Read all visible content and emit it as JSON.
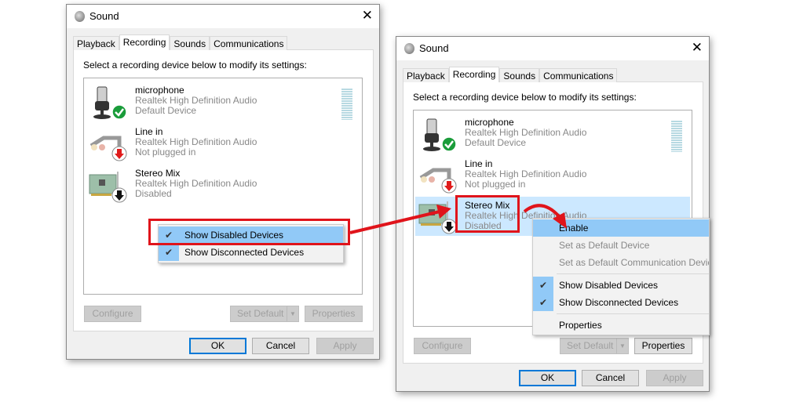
{
  "dialogs": [
    {
      "title": "Sound",
      "tabs": [
        "Playback",
        "Recording",
        "Sounds",
        "Communications"
      ],
      "instruction": "Select a recording device below to modify its settings:",
      "devices": [
        {
          "name": "microphone",
          "driver": "Realtek High Definition Audio",
          "status": "Default Device",
          "badge": "check-icon"
        },
        {
          "name": "Line in",
          "driver": "Realtek High Definition Audio",
          "status": "Not plugged in",
          "badge": "red-down-arrow-icon"
        },
        {
          "name": "Stereo Mix",
          "driver": "Realtek High Definition Audio",
          "status": "Disabled",
          "badge": "black-down-arrow-icon"
        }
      ],
      "buttons": {
        "configure": "Configure",
        "set_default": "Set Default",
        "properties": "Properties",
        "ok": "OK",
        "cancel": "Cancel",
        "apply": "Apply"
      },
      "menu": [
        {
          "label": "Show Disabled Devices",
          "checked": true
        },
        {
          "label": "Show Disconnected Devices",
          "checked": true
        }
      ]
    },
    {
      "title": "Sound",
      "tabs": [
        "Playback",
        "Recording",
        "Sounds",
        "Communications"
      ],
      "instruction": "Select a recording device below to modify its settings:",
      "devices": [
        {
          "name": "microphone",
          "driver": "Realtek High Definition Audio",
          "status": "Default Device",
          "badge": "check-icon"
        },
        {
          "name": "Line in",
          "driver": "Realtek High Definition Audio",
          "status": "Not plugged in",
          "badge": "red-down-arrow-icon"
        },
        {
          "name": "Stereo Mix",
          "driver": "Realtek High Definition Audio",
          "status": "Disabled",
          "badge": "black-down-arrow-icon",
          "selected": true
        }
      ],
      "buttons": {
        "configure": "Configure",
        "set_default": "Set Default",
        "properties": "Properties",
        "ok": "OK",
        "cancel": "Cancel",
        "apply": "Apply"
      },
      "menu": [
        {
          "label": "Enable"
        },
        {
          "label": "Set as Default Device"
        },
        {
          "label": "Set as Default Communication Device"
        },
        {
          "label": "Show Disabled Devices",
          "checked": true
        },
        {
          "label": "Show Disconnected Devices",
          "checked": true
        },
        {
          "label": "Properties"
        }
      ]
    }
  ],
  "colors": {
    "highlight_box": "#e0141b",
    "menu_highlight": "#91c9f7",
    "selection": "#cce8ff"
  }
}
